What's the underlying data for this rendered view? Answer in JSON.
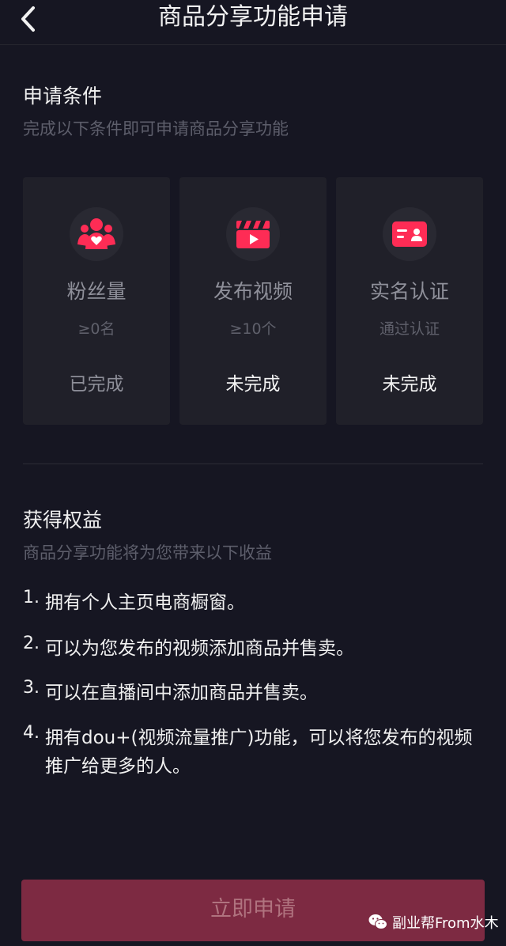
{
  "header": {
    "title": "商品分享功能申请",
    "back_icon": "chevron-left-icon"
  },
  "conditions": {
    "title": "申请条件",
    "subtitle": "完成以下条件即可申请商品分享功能",
    "items": [
      {
        "icon": "fans-icon",
        "label": "粉丝量",
        "requirement": "≥0名",
        "status": "已完成",
        "done": true
      },
      {
        "icon": "video-clapper-icon",
        "label": "发布视频",
        "requirement": "≥10个",
        "status": "未完成",
        "done": false
      },
      {
        "icon": "id-card-icon",
        "label": "实名认证",
        "requirement": "通过认证",
        "status": "未完成",
        "done": false
      }
    ]
  },
  "benefits": {
    "title": "获得权益",
    "subtitle": "商品分享功能将为您带来以下收益",
    "items": [
      {
        "num": "1.",
        "text": "拥有个人主页电商橱窗。"
      },
      {
        "num": "2.",
        "text": "可以为您发布的视频添加商品并售卖。"
      },
      {
        "num": "3.",
        "text": "可以在直播间中添加商品并售卖。"
      },
      {
        "num": "4.",
        "text": "拥有dou+(视频流量推广)功能，可以将您发布的视频推广给更多的人。"
      }
    ]
  },
  "apply_button": {
    "label": "立即申请"
  },
  "watermark": {
    "text": "副业帮From水木"
  },
  "colors": {
    "background": "#161622",
    "card": "#202029",
    "accent": "#fe2c55",
    "button": "#7d2a42"
  }
}
